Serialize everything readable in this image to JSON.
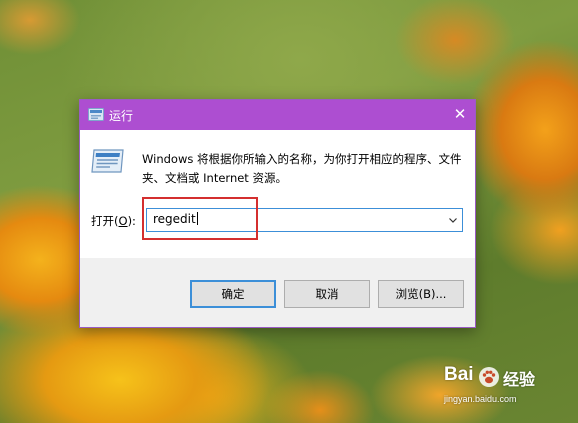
{
  "window": {
    "title": "运行",
    "close_glyph": "✕",
    "description": "Windows 将根据你所输入的名称，为你打开相应的程序、文件夹、文档或 Internet 资源。",
    "open_label_prefix": "打开(",
    "open_label_accel": "O",
    "open_label_suffix": "):",
    "command_value": "regedit",
    "buttons": {
      "ok": "确定",
      "cancel": "取消",
      "browse": "浏览(B)..."
    }
  },
  "watermark": {
    "brand": "Bai",
    "service": "经验",
    "url": "jingyan.baidu.com"
  },
  "colors": {
    "titlebar": "#ad4ed1",
    "highlight_box": "#d42f2f",
    "focus_border": "#3c8fd8"
  },
  "icons": {
    "title": "run-icon",
    "dialog": "run-icon",
    "dropdown": "chevron-down-icon",
    "close": "close-icon",
    "watermark": "paw-icon"
  }
}
